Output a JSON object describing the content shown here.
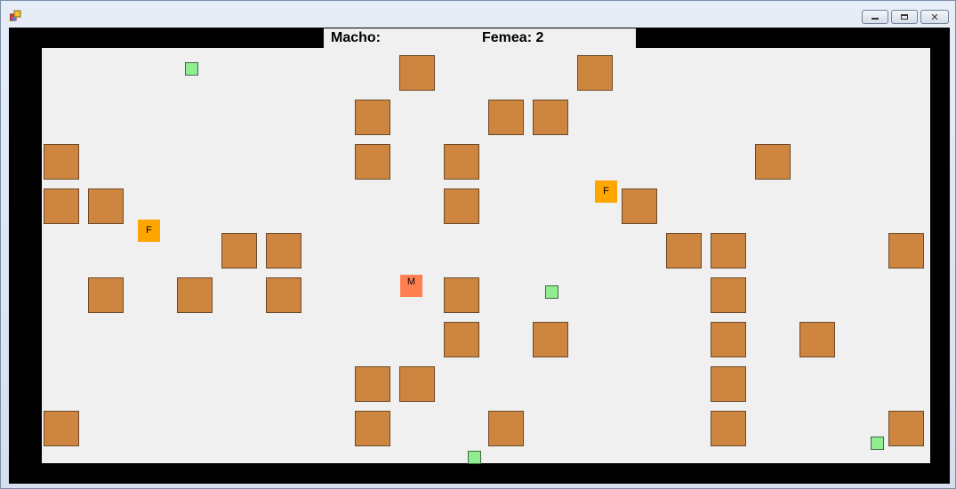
{
  "hud": {
    "macho_label": "Macho:",
    "femea_label": "Femea: 2"
  },
  "agents": {
    "female_letter": "F",
    "male_letter": "M"
  },
  "colors": {
    "wall": "#cd853f",
    "food": "#90ee90",
    "female": "#ffa500",
    "male": "#ff7f50",
    "field": "#f0f0f0",
    "border": "#000000"
  },
  "icons": [
    "app-icon",
    "minimize-icon",
    "maximize-icon",
    "close-icon"
  ]
}
